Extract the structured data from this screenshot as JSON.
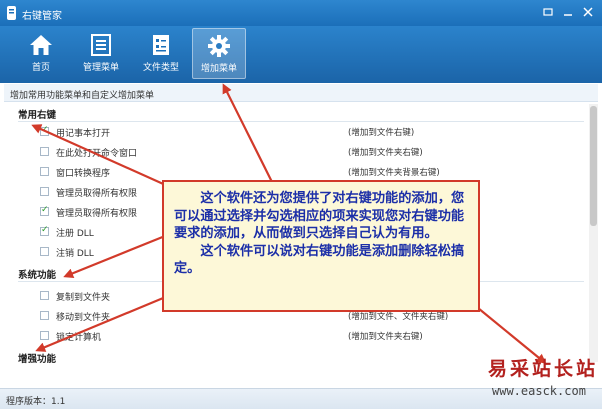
{
  "window": {
    "title": "右键管家"
  },
  "toolbar": {
    "items": [
      {
        "label": "首页",
        "icon": "home-icon"
      },
      {
        "label": "管理菜单",
        "icon": "menu-list-icon"
      },
      {
        "label": "文件类型",
        "icon": "file-type-icon"
      },
      {
        "label": "增加菜单",
        "icon": "gear-icon",
        "active": true
      }
    ]
  },
  "subtitle": "增加常用功能菜单和自定义增加菜单",
  "sections": [
    {
      "title": "常用右键",
      "items": [
        {
          "name": "用记事本打开",
          "desc": "(增加到文件右键)",
          "checked": true
        },
        {
          "name": "在此处打开命令窗口",
          "desc": "(增加到文件夹右键)",
          "checked": false
        },
        {
          "name": "窗口转换程序",
          "desc": "(增加到文件夹背景右键)",
          "checked": false
        },
        {
          "name": "管理员取得所有权限",
          "desc": "",
          "checked": false
        },
        {
          "name": "管理员取得所有权限",
          "desc": "",
          "checked": true
        },
        {
          "name": "注册 DLL",
          "desc": "",
          "checked": true
        },
        {
          "name": "注销 DLL",
          "desc": "",
          "checked": false
        }
      ]
    },
    {
      "title": "系统功能",
      "items": [
        {
          "name": "复制到文件夹",
          "desc": "",
          "checked": false
        },
        {
          "name": "移动到文件夹",
          "desc": "(增加到文件、文件夹右键)",
          "checked": false
        },
        {
          "name": "锁定计算机",
          "desc": "(增加到文件夹右键)",
          "checked": false
        }
      ]
    },
    {
      "title": "增强功能",
      "items": []
    }
  ],
  "status": {
    "version": "程序版本：1.1"
  },
  "annotation": {
    "paragraph1": "这个软件还为您提供了对右键功能的添加，您可以通过选择并勾选相应的项来实现您对右键功能要求的添加，从而做到只选择自己认为有用。",
    "paragraph2": "这个软件可以说对右键功能是添加删除轻松搞定。"
  },
  "watermark": {
    "name": "易采站长站",
    "url": "www.easck.com"
  },
  "colors": {
    "titlebar": "#1b6fb9",
    "arrow": "#d23a2a",
    "callout_text": "#1c2fa8",
    "callout_bg": "#fdf8d8"
  }
}
